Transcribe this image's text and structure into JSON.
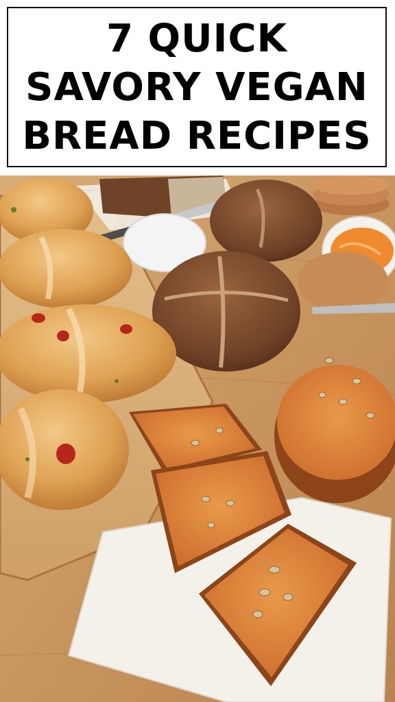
{
  "pin": {
    "title_lines": [
      "7 QUICK",
      "SAVORY VEGAN",
      "BREAD RECIPES"
    ],
    "photo_subject": "savory-vegan-breads-photo"
  },
  "colors": {
    "title_text": "#000000",
    "title_border": "#111111",
    "background": "#ffffff",
    "wood": "#c99a66",
    "crust_dark": "#6b3f22",
    "crumb_orange": "#d9742e",
    "roll_golden": "#e0a458"
  }
}
